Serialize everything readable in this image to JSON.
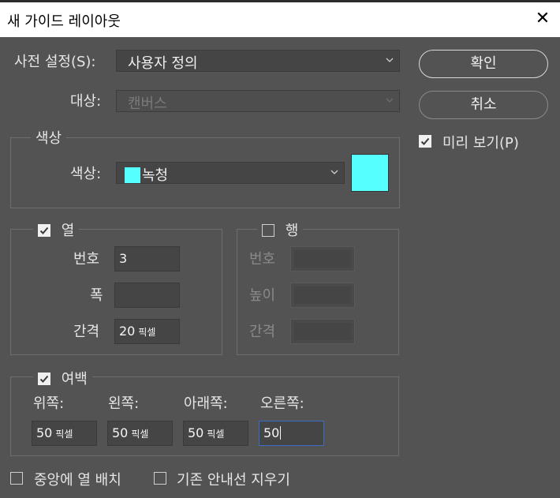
{
  "window": {
    "title": "새 가이드 레이아웃",
    "close_glyph": "✕"
  },
  "preset": {
    "label": "사전 설정(S):",
    "value": "사용자 정의"
  },
  "target": {
    "label": "대상:",
    "value": "캔버스"
  },
  "buttons": {
    "ok": "확인",
    "cancel": "취소"
  },
  "preview": {
    "label": "미리 보기(P)",
    "checked": true
  },
  "color_group": {
    "legend": "색상",
    "label": "색상:",
    "value": "녹청",
    "swatch_color": "#55ffff"
  },
  "columns": {
    "legend": "열",
    "checked": true,
    "number_label": "번호",
    "number_value": "3",
    "width_label": "폭",
    "width_value": "",
    "gutter_label": "간격",
    "gutter_value": "20",
    "gutter_unit": "픽셀"
  },
  "rows": {
    "legend": "행",
    "checked": false,
    "number_label": "번호",
    "height_label": "높이",
    "gutter_label": "간격"
  },
  "margin": {
    "legend": "여백",
    "checked": true,
    "top_label": "위쪽:",
    "top_value": "50",
    "top_unit": "픽셀",
    "left_label": "왼쪽:",
    "left_value": "50",
    "left_unit": "픽셀",
    "bottom_label": "아래쪽:",
    "bottom_value": "50",
    "bottom_unit": "픽셀",
    "right_label": "오른쪽:",
    "right_value": "50"
  },
  "options": {
    "center_columns": "중앙에 열 배치",
    "center_checked": false,
    "clear_existing": "기존 안내선 지우기",
    "clear_checked": false
  }
}
